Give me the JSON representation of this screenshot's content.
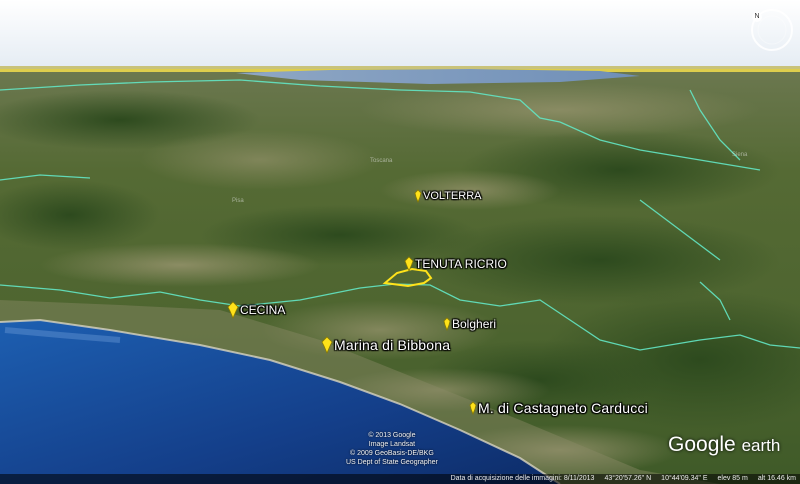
{
  "places": [
    {
      "id": "volterra",
      "label": "VOLTERRA",
      "size": "sm"
    },
    {
      "id": "tenuta",
      "label": "TENUTA RICRIO",
      "size": "md"
    },
    {
      "id": "cecina",
      "label": "CECINA",
      "size": "md"
    },
    {
      "id": "bolgheri",
      "label": "Bolgheri",
      "size": "md"
    },
    {
      "id": "bibbona",
      "label": "Marina di Bibbona",
      "size": "lg"
    },
    {
      "id": "castagneto",
      "label": "M. di Castagneto Carducci",
      "size": "lg"
    }
  ],
  "faint_labels": {
    "toscana": "Toscana",
    "pisa": "Pisa",
    "siena": "Siena"
  },
  "attribution": {
    "line1": "© 2013 Google",
    "line2": "Image Landsat",
    "line3": "© 2009 GeoBasis-DE/BKG",
    "line4": "US Dept of State Geographer"
  },
  "logo": {
    "google": "Google",
    "earth": "earth"
  },
  "status_bar": {
    "imagery_date": "Data di acquisizione delle immagini: 8/11/2013",
    "lat": "43°20'57.26\" N",
    "lon": "10°44'09.34\" E",
    "elev": "elev    85 m",
    "alt": "alt  16.46 km"
  },
  "nav": {
    "north": "N"
  },
  "colors": {
    "boundary": "#63e6c4",
    "placemark": "#ffe21a",
    "sea": "#1a4fa0"
  }
}
